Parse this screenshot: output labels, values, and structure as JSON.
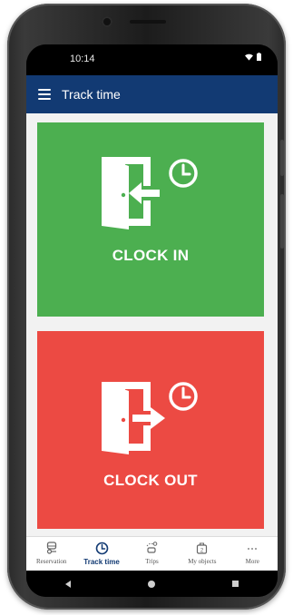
{
  "status_bar": {
    "time": "10:14",
    "icons": [
      "wifi-icon",
      "battery-icon"
    ]
  },
  "app_bar": {
    "title": "Track time",
    "menu_icon": "hamburger-menu-icon",
    "color": "#123a73"
  },
  "actions": {
    "clock_in": {
      "label": "CLOCK IN",
      "icon": "door-enter-clock-icon",
      "color": "#4caf50"
    },
    "clock_out": {
      "label": "CLOCK OUT",
      "icon": "door-exit-clock-icon",
      "color": "#ec4a43"
    }
  },
  "bottom_nav": {
    "items": [
      {
        "label": "Reservation",
        "icon": "car-key-icon",
        "active": false
      },
      {
        "label": "Track time",
        "icon": "clock-icon",
        "active": true
      },
      {
        "label": "Trips",
        "icon": "route-car-icon",
        "active": false
      },
      {
        "label": "My objects",
        "icon": "object-bag-icon",
        "active": false
      },
      {
        "label": "More",
        "icon": "more-dots-icon",
        "active": false
      }
    ],
    "active_color": "#123a73"
  },
  "system_nav": {
    "buttons": [
      "back-icon",
      "home-icon",
      "recent-apps-icon"
    ]
  }
}
